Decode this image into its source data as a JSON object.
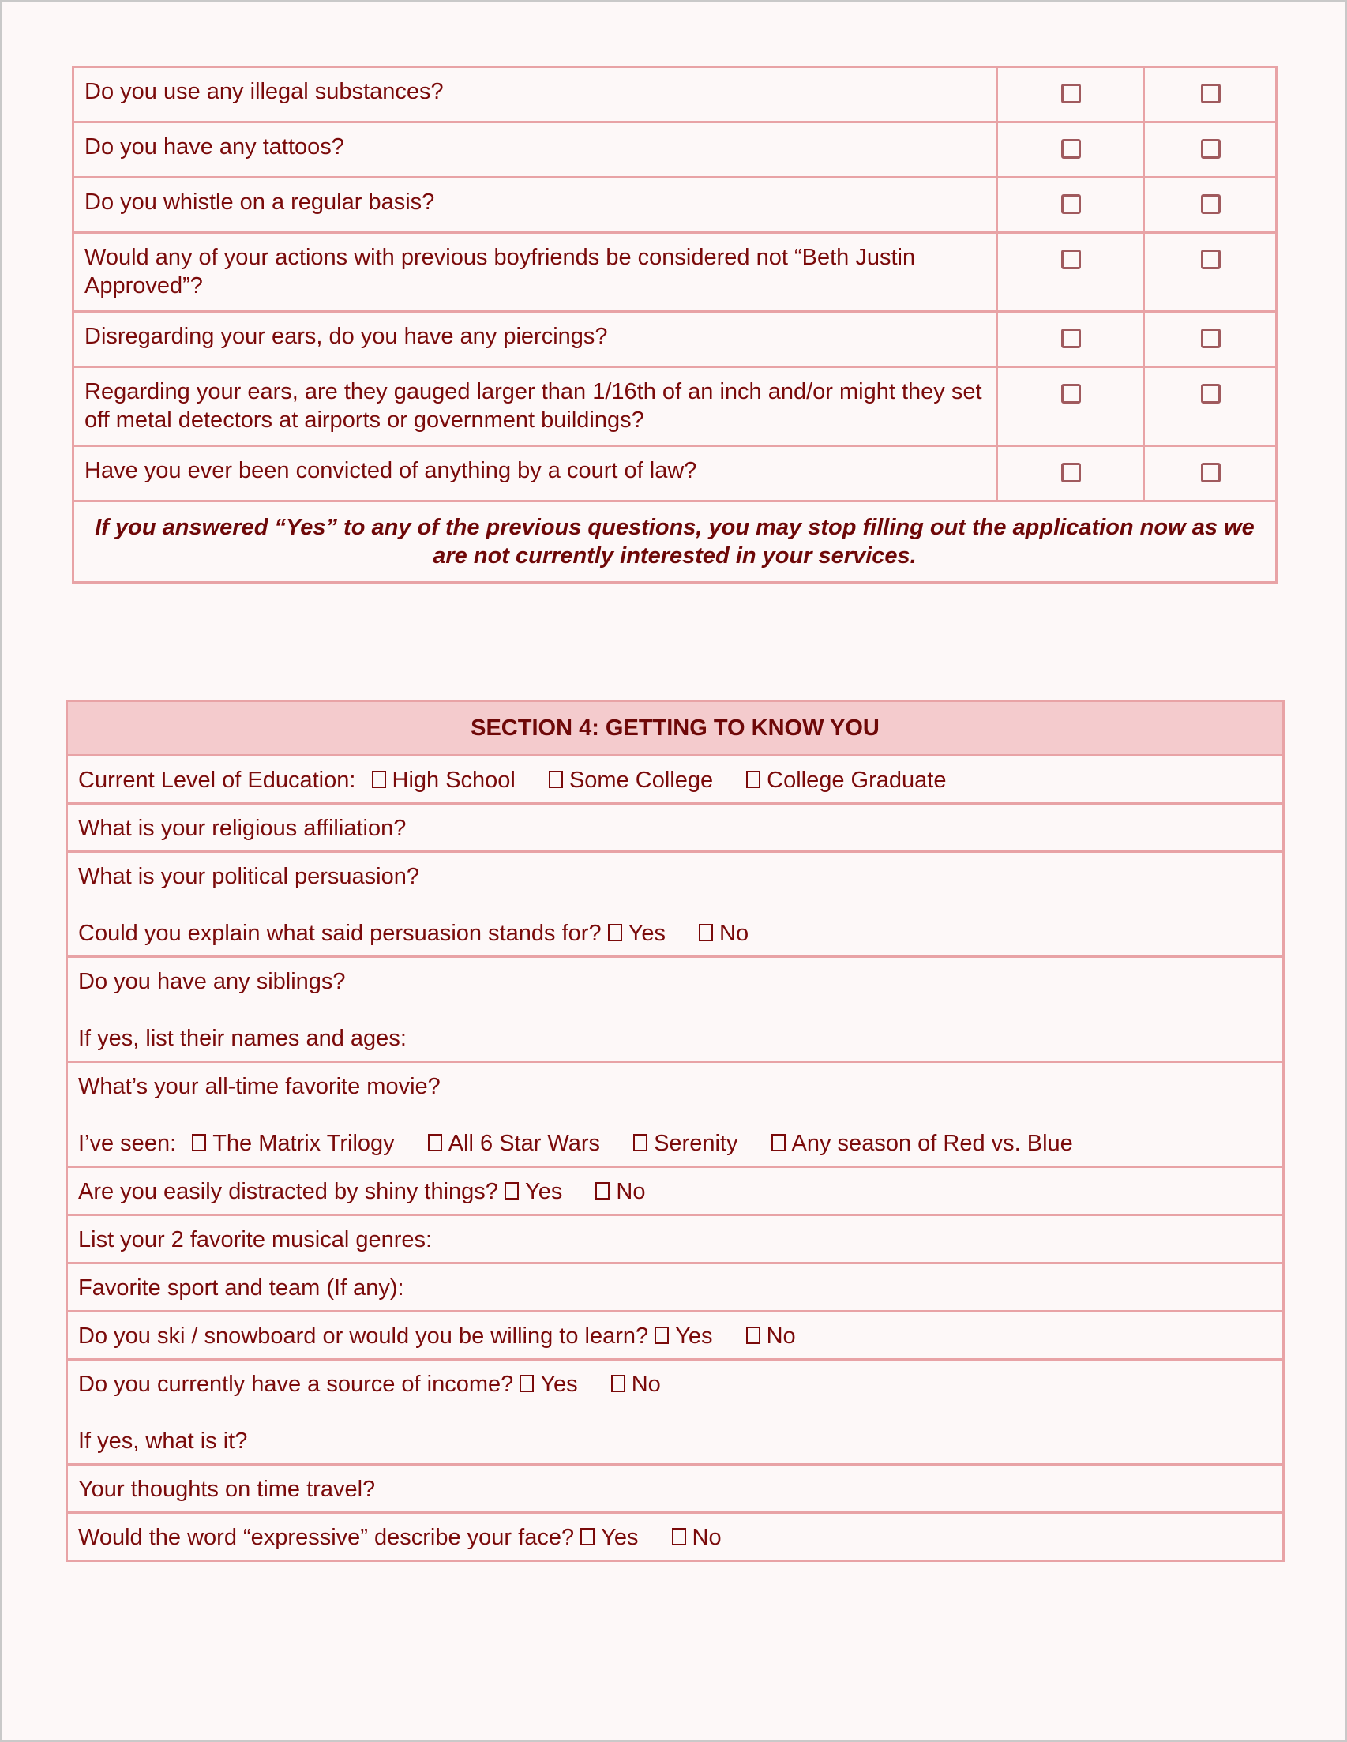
{
  "section3": {
    "questions": [
      {
        "text": "Do you use any illegal substances?"
      },
      {
        "text": "Do you have any tattoos?"
      },
      {
        "text": "Do you whistle on a regular basis?"
      },
      {
        "text": "Would any of your actions with previous boyfriends be considered not “Beth Justin Approved”?"
      },
      {
        "text": "Disregarding your ears, do you have any piercings?"
      },
      {
        "text": "Regarding your ears, are they gauged larger than 1/16th of an inch and/or might they set off metal detectors at airports or government buildings?"
      },
      {
        "text": "Have you ever been convicted of anything by a court of law?"
      }
    ],
    "note": "If you answered “Yes” to any of the previous questions, you may stop filling out the application now as we are not currently interested in your services."
  },
  "section4": {
    "title": "SECTION 4: GETTING TO KNOW YOU",
    "education": {
      "label": "Current Level of Education:",
      "options": [
        "High School",
        "Some College",
        "College Graduate"
      ]
    },
    "religion": "What is your religious affiliation?",
    "politics": {
      "q1": "What is your political persuasion?",
      "q2": "Could you explain what said persuasion stands for?",
      "options": [
        "Yes",
        "No"
      ]
    },
    "siblings": {
      "q1": "Do you have any siblings?",
      "q2": "If yes, list their names and ages:"
    },
    "movie": {
      "q1": "What’s your all-time favorite movie?",
      "seen_label": "I’ve seen:",
      "options": [
        "The Matrix Trilogy",
        "All 6 Star Wars",
        "Serenity",
        "Any season of Red vs. Blue"
      ]
    },
    "shiny": {
      "q": "Are you easily distracted by shiny things?",
      "options": [
        "Yes",
        "No"
      ]
    },
    "music": "List your 2 favorite musical genres:",
    "sport": "Favorite sport and team (If any):",
    "ski": {
      "q": "Do you ski / snowboard or would you be willing to learn?",
      "options": [
        "Yes",
        "No"
      ]
    },
    "income": {
      "q1": "Do you currently have a source of income?",
      "q2": "If yes, what is it?",
      "options": [
        "Yes",
        "No"
      ]
    },
    "time_travel": "Your thoughts on time travel?",
    "expressive": {
      "q": "Would the word “expressive” describe your face?",
      "options": [
        "Yes",
        "No"
      ]
    }
  }
}
